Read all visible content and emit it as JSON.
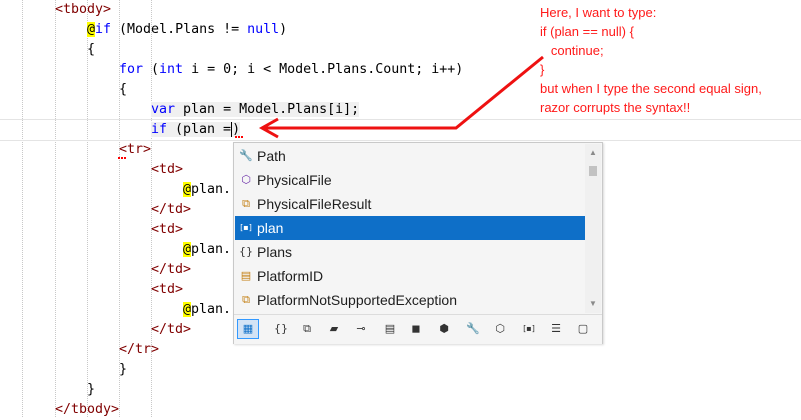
{
  "code_lines": [
    {
      "segments": [
        {
          "t": "<tbody>",
          "c": "tag"
        }
      ]
    },
    {
      "segments": [
        {
          "t": "@",
          "c": "razor"
        },
        {
          "t": "if",
          "c": "kw"
        },
        {
          "t": " (Model.Plans != ",
          "c": ""
        },
        {
          "t": "null",
          "c": "kw"
        },
        {
          "t": ")",
          "c": ""
        }
      ]
    },
    {
      "segments": [
        {
          "t": "{",
          "c": ""
        }
      ]
    },
    {
      "segments": [
        {
          "t": "for",
          "c": "kw"
        },
        {
          "t": " (",
          "c": ""
        },
        {
          "t": "int",
          "c": "kw"
        },
        {
          "t": " i = 0; i < Model.Plans.Count; i++)",
          "c": ""
        }
      ]
    },
    {
      "segments": [
        {
          "t": "{",
          "c": ""
        }
      ]
    },
    {
      "segments": [
        {
          "t": "var",
          "c": "kw"
        },
        {
          "t": " plan = Model.Plans[i];",
          "c": ""
        }
      ]
    },
    {
      "segments": [
        {
          "t": "if",
          "c": "kw"
        },
        {
          "t": " (plan =",
          "c": ""
        }
      ]
    },
    {
      "segments": [
        {
          "t": "<tr>",
          "c": "tag"
        }
      ]
    },
    {
      "segments": [
        {
          "t": "<td>",
          "c": "tag"
        }
      ]
    },
    {
      "segments": [
        {
          "t": "@",
          "c": "razor"
        },
        {
          "t": "plan.",
          "c": ""
        }
      ]
    },
    {
      "segments": [
        {
          "t": "</td>",
          "c": "tag"
        }
      ]
    },
    {
      "segments": [
        {
          "t": "<td>",
          "c": "tag"
        }
      ]
    },
    {
      "segments": [
        {
          "t": "@",
          "c": "razor"
        },
        {
          "t": "plan.",
          "c": ""
        }
      ]
    },
    {
      "segments": [
        {
          "t": "</td>",
          "c": "tag"
        }
      ]
    },
    {
      "segments": [
        {
          "t": "<td>",
          "c": "tag"
        }
      ]
    },
    {
      "segments": [
        {
          "t": "@",
          "c": "razor"
        },
        {
          "t": "plan.",
          "c": ""
        }
      ]
    },
    {
      "segments": [
        {
          "t": "</td>",
          "c": "tag"
        }
      ]
    },
    {
      "segments": [
        {
          "t": "</tr>",
          "c": "tag"
        }
      ]
    },
    {
      "segments": [
        {
          "t": "}",
          "c": ""
        }
      ]
    },
    {
      "segments": [
        {
          "t": "}",
          "c": ""
        }
      ]
    },
    {
      "segments": [
        {
          "t": "</tbody>",
          "c": "tag"
        }
      ]
    }
  ],
  "annotation": {
    "lines": [
      "Here, I want to type:",
      "if (plan == null) {",
      "   continue;",
      "}",
      "but when I type the second equal sign,",
      "razor corrupts the syntax!!"
    ],
    "color": "#ff1a1a"
  },
  "completion": {
    "items": [
      {
        "label": "Path",
        "icon": "wrench-icon",
        "glyph": "🔧",
        "color": "#333333"
      },
      {
        "label": "PhysicalFile",
        "icon": "method-icon",
        "glyph": "⬡",
        "color": "#6c2fa8"
      },
      {
        "label": "PhysicalFileResult",
        "icon": "class-icon",
        "glyph": "⧉",
        "color": "#c27d0e"
      },
      {
        "label": "plan",
        "icon": "local-variable-icon",
        "glyph": "[▪]",
        "color": "#ffffff",
        "selected": true
      },
      {
        "label": "Plans",
        "icon": "namespace-icon",
        "glyph": "{}",
        "color": "#333333"
      },
      {
        "label": "PlatformID",
        "icon": "enum-icon",
        "glyph": "▤",
        "color": "#c27d0e"
      },
      {
        "label": "PlatformNotSupportedException",
        "icon": "class-icon",
        "glyph": "⧉",
        "color": "#c27d0e"
      }
    ],
    "selected_color": "#0e6fc8",
    "filters": [
      {
        "name": "all-filter-icon",
        "glyph": "▦",
        "active": true
      },
      {
        "name": "namespace-filter-icon",
        "glyph": "{}"
      },
      {
        "name": "class-filter-icon",
        "glyph": "⧉"
      },
      {
        "name": "structure-filter-icon",
        "glyph": "▰"
      },
      {
        "name": "interface-filter-icon",
        "glyph": "⊸"
      },
      {
        "name": "enum-filter-icon",
        "glyph": "▤"
      },
      {
        "name": "delegate-filter-icon",
        "glyph": "◼"
      },
      {
        "name": "module-filter-icon",
        "glyph": "⬢"
      },
      {
        "name": "extension-method-filter-icon",
        "glyph": "🔧"
      },
      {
        "name": "method-filter-icon",
        "glyph": "⬡"
      },
      {
        "name": "local-filter-icon",
        "glyph": "[▪]"
      },
      {
        "name": "snippet-filter-icon",
        "glyph": "☰"
      },
      {
        "name": "keyword-filter-icon",
        "glyph": "▢"
      }
    ]
  }
}
